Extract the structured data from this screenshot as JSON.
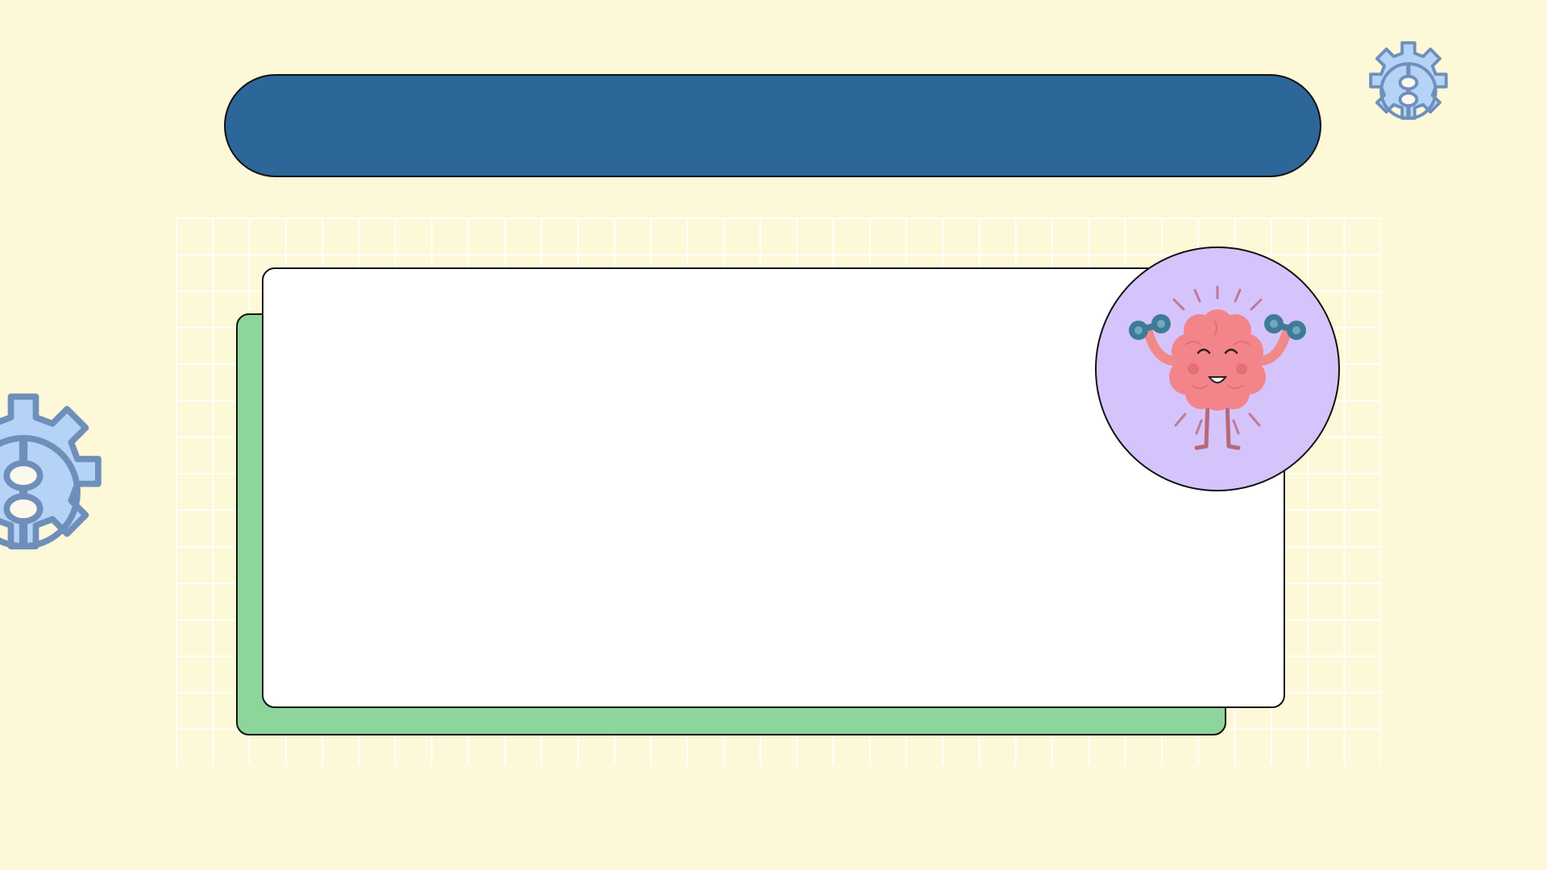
{
  "slide": {
    "title": "",
    "body_text": "",
    "colors": {
      "background": "#fdf8d8",
      "title_bar": "#2d6698",
      "card_front": "#ffffff",
      "card_back": "#8ed59b",
      "badge": "#d5c4fc",
      "gear_fill": "#b5d3f6",
      "gear_stroke": "#6f8fbb"
    },
    "icons": [
      "brain-lifting-dumbbells-illustration",
      "gear-bone-joint-icon"
    ]
  }
}
